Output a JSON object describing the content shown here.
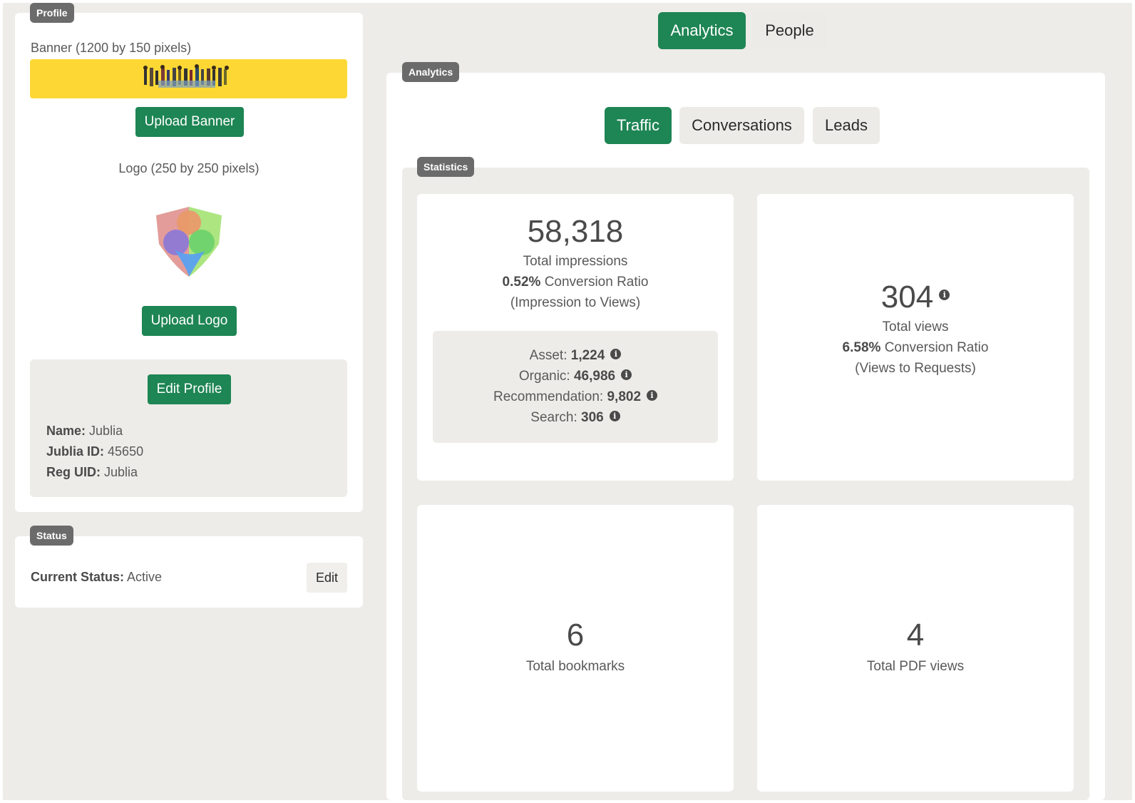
{
  "profile": {
    "tag": "Profile",
    "banner_label": "Banner (1200 by 150 pixels)",
    "upload_banner": "Upload Banner",
    "logo_label": "Logo (250 by 250 pixels)",
    "upload_logo": "Upload Logo",
    "edit_profile": "Edit Profile",
    "fields": [
      {
        "label": "Name:",
        "value": "Jublia"
      },
      {
        "label": "Jublia ID:",
        "value": "45650"
      },
      {
        "label": "Reg UID:",
        "value": "Jublia"
      }
    ],
    "banner_color": "#fdd835"
  },
  "status": {
    "tag": "Status",
    "label": "Current Status:",
    "value": "Active",
    "edit": "Edit"
  },
  "top_tabs": [
    {
      "label": "Analytics",
      "active": true
    },
    {
      "label": "People",
      "active": false
    }
  ],
  "analytics": {
    "tag": "Analytics",
    "tabs": [
      {
        "label": "Traffic",
        "active": true
      },
      {
        "label": "Conversations",
        "active": false
      },
      {
        "label": "Leads",
        "active": false
      }
    ]
  },
  "statistics": {
    "tag": "Statistics",
    "impressions": {
      "value": "58,318",
      "label": "Total impressions",
      "ratio": "0.52%",
      "ratio_label": "Conversion Ratio",
      "ratio_note": "(Impression to Views)",
      "breakdown": [
        {
          "label": "Asset:",
          "value": "1,224"
        },
        {
          "label": "Organic:",
          "value": "46,986"
        },
        {
          "label": "Recommendation:",
          "value": "9,802"
        },
        {
          "label": "Search:",
          "value": "306"
        }
      ]
    },
    "views": {
      "value": "304",
      "label": "Total views",
      "ratio": "6.58%",
      "ratio_label": "Conversion Ratio",
      "ratio_note": "(Views to Requests)"
    },
    "bookmarks": {
      "value": "6",
      "label": "Total bookmarks"
    },
    "pdf_views": {
      "value": "4",
      "label": "Total PDF views"
    }
  },
  "colors": {
    "accent": "#1e8554",
    "background": "#edece8",
    "tag": "#6b6b6b"
  },
  "icons": [
    "info-icon",
    "logo-shield-icon",
    "banner-people-image"
  ]
}
